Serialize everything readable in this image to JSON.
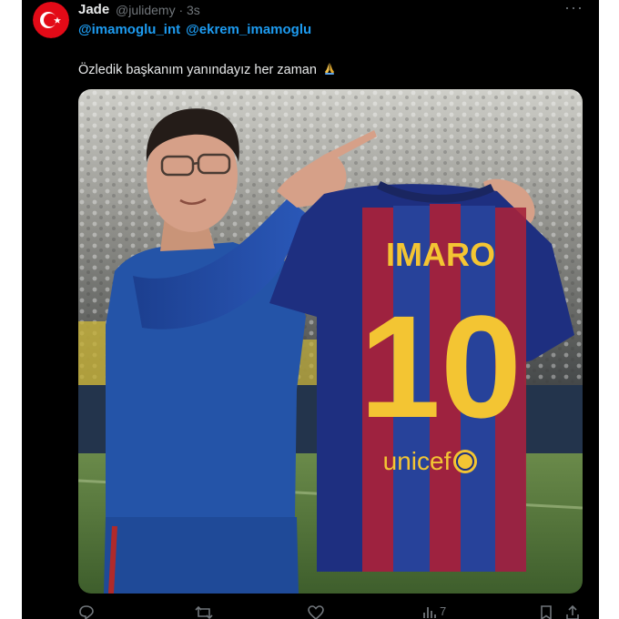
{
  "tweet": {
    "display_name": "Jade",
    "handle_time": "@julidemy · 3s",
    "more_icon": "more-dots-icon",
    "mentions": [
      "@imamoglu_int",
      "@ekrem_imamoglu"
    ],
    "text": "Özledik başkanım yanındayız her zaman",
    "emoji": "folded-hands-emoji"
  },
  "media": {
    "jersey_name": "IMARO",
    "jersey_number": "10",
    "jersey_sponsor": "unicef"
  },
  "actions": {
    "reply_icon": "reply-icon",
    "retweet_icon": "retweet-icon",
    "like_icon": "heart-icon",
    "views_icon": "views-icon",
    "views_count": "7",
    "bookmark_icon": "bookmark-icon",
    "share_icon": "share-icon"
  },
  "colors": {
    "background": "#000000",
    "text": "#e7e9ea",
    "secondary": "#71767b",
    "link": "#1d9bf0"
  }
}
